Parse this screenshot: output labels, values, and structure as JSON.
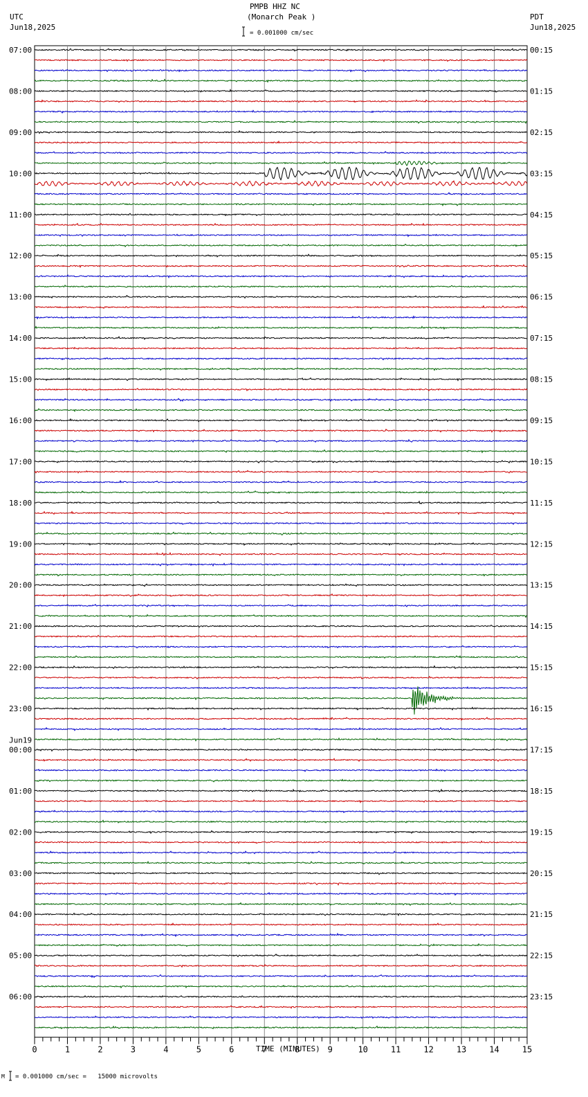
{
  "header": {
    "station": "PMPB HHZ NC",
    "location": "(Monarch Peak )",
    "left_tz": "UTC",
    "left_date": "Jun18,2025",
    "right_tz": "PDT",
    "right_date": "Jun18,2025",
    "scale": "= 0.001000 cm/sec"
  },
  "footer": {
    "scale": "= 0.001000 cm/sec =   15000 microvolts",
    "mark": "M"
  },
  "chart_data": {
    "type": "line",
    "title": "PMPB HHZ NC (Monarch Peak )",
    "xlabel": "TIME (MINUTES)",
    "xlim": [
      0,
      15
    ],
    "x_ticks": [
      "0",
      "1",
      "2",
      "3",
      "4",
      "5",
      "6",
      "7",
      "8",
      "9",
      "10",
      "11",
      "12",
      "13",
      "14",
      "15"
    ],
    "traces_per_hour": 4,
    "trace_count": 96,
    "trace_colors": [
      "#000000",
      "#cc0000",
      "#0000cc",
      "#006600"
    ],
    "date_change_label": "Jun19",
    "left_labels": [
      "07:00",
      "08:00",
      "09:00",
      "10:00",
      "11:00",
      "12:00",
      "13:00",
      "14:00",
      "15:00",
      "16:00",
      "17:00",
      "18:00",
      "19:00",
      "20:00",
      "21:00",
      "22:00",
      "23:00",
      "00:00",
      "01:00",
      "02:00",
      "03:00",
      "04:00",
      "05:00",
      "06:00"
    ],
    "right_labels": [
      "00:15",
      "01:15",
      "02:15",
      "03:15",
      "04:15",
      "05:15",
      "06:15",
      "07:15",
      "08:15",
      "09:15",
      "10:15",
      "11:15",
      "12:15",
      "13:15",
      "14:15",
      "15:15",
      "16:15",
      "17:15",
      "18:15",
      "19:15",
      "20:15",
      "21:15",
      "22:15",
      "23:15"
    ],
    "events": [
      {
        "trace": 11,
        "start_min": 11,
        "end_min": 12.5,
        "amplitude": 3,
        "period_min": 0.15
      },
      {
        "trace": 12,
        "start_min": 7,
        "end_min": 15,
        "amplitude": 9,
        "period_min": 0.22
      },
      {
        "trace": 13,
        "start_min": 0,
        "end_min": 15,
        "amplitude": 3,
        "period_min": 0.2
      },
      {
        "trace": 63,
        "start_min": 11.5,
        "end_min": 13.5,
        "amplitude": 24,
        "period_min": 0.03
      }
    ]
  }
}
